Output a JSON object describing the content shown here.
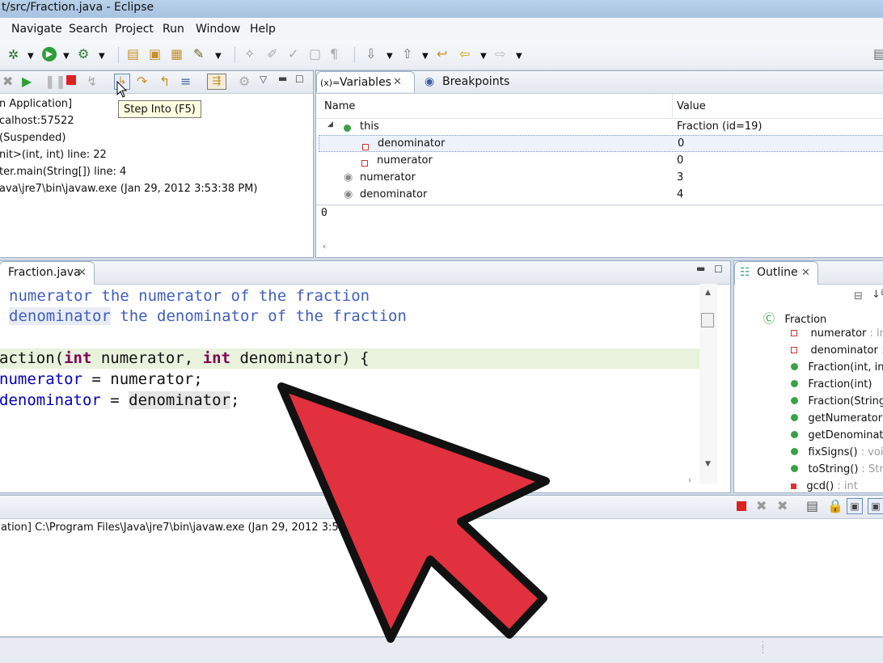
{
  "window": {
    "title": "t/src/Fraction.java - Eclipse"
  },
  "menu": [
    "Navigate",
    "Search",
    "Project",
    "Run",
    "Window",
    "Help"
  ],
  "tooltip": "Step Into (F5)",
  "debug": {
    "lines": [
      "n Application]",
      "calhost:57522",
      "(Suspended)",
      "nit>(int, int) line: 22",
      "ter.main(String[]) line: 4",
      "ava\\jre7\\bin\\javaw.exe (Jan 29, 2012 3:53:38 PM)"
    ]
  },
  "variables": {
    "tab_label": "Variables",
    "tab_prefix": "(x)=",
    "breakpoints_label": "Breakpoints",
    "col_name": "Name",
    "col_value": "Value",
    "rows": [
      {
        "name": "this",
        "value": "Fraction  (id=19)"
      },
      {
        "name": "denominator",
        "value": "0"
      },
      {
        "name": "numerator",
        "value": "0"
      },
      {
        "name": "numerator",
        "value": "3"
      },
      {
        "name": "denominator",
        "value": "4"
      }
    ],
    "detail": "0"
  },
  "editor": {
    "tab_label": "Fraction.java",
    "doc1_a": "numerator",
    "doc1_b": " the numerator of the fraction",
    "doc2_a": "denominator",
    "doc2_b": " the denominator of the fraction",
    "sig_a": "action(",
    "sig_kw1": "int",
    "sig_b": " numerator, ",
    "sig_kw2": "int",
    "sig_c": " denominator) {",
    "l2_a": "numerator",
    "l2_b": " = numerator;",
    "l3_a": "denominator",
    "l3_b": " = ",
    "l3_c": "denominator",
    "l3_d": ";"
  },
  "outline": {
    "tab_label": "Outline",
    "root": "Fraction",
    "items": [
      {
        "name": "numerator",
        "type": " : in"
      },
      {
        "name": "denominator",
        "type": " :"
      },
      {
        "name": "Fraction(int, in",
        "type": ""
      },
      {
        "name": "Fraction(int)",
        "type": ""
      },
      {
        "name": "Fraction(String",
        "type": ""
      },
      {
        "name": "getNumerator",
        "type": ""
      },
      {
        "name": "getDenominat",
        "type": ""
      },
      {
        "name": "fixSigns()",
        "type": " : voic"
      },
      {
        "name": "toString()",
        "type": " : Stri"
      },
      {
        "name": "gcd()",
        "type": " : int"
      }
    ]
  },
  "console": {
    "line": "ation] C:\\Program Files\\Java\\jre7\\bin\\javaw.exe (Jan 29, 2012 3:53:38"
  },
  "colors": {
    "arrow_fill": "#e1303e",
    "arrow_stroke": "#111111"
  }
}
